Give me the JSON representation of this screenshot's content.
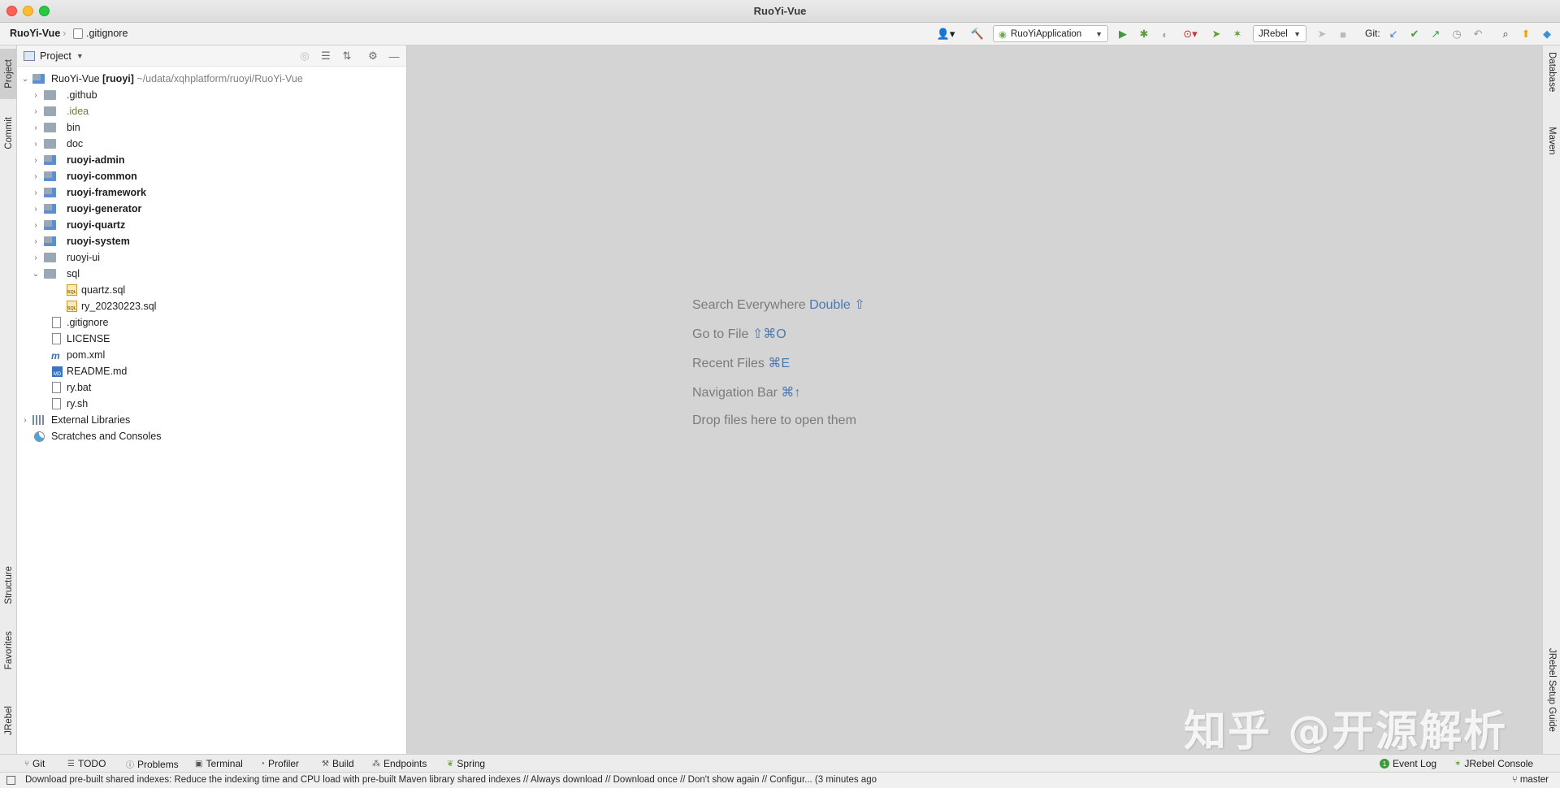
{
  "window": {
    "title": "RuoYi-Vue"
  },
  "breadcrumb": {
    "root": "RuoYi-Vue",
    "file": ".gitignore"
  },
  "toolbar": {
    "run_config": "RuoYiApplication",
    "jrebel": "JRebel",
    "git_label": "Git:"
  },
  "left_tabs": {
    "project": "Project",
    "commit": "Commit",
    "structure": "Structure",
    "favorites": "Favorites",
    "jrebel": "JRebel"
  },
  "right_tabs": {
    "database": "Database",
    "maven": "Maven",
    "jrebel_guide": "JRebel Setup Guide"
  },
  "project_panel": {
    "title": "Project",
    "tree": [
      {
        "label": "RuoYi-Vue",
        "module": "[ruoyi]",
        "path": "~/udata/xqhplatform/ruoyi/RuoYi-Vue"
      },
      {
        "label": ".github"
      },
      {
        "label": ".idea"
      },
      {
        "label": "bin"
      },
      {
        "label": "doc"
      },
      {
        "label": "ruoyi-admin"
      },
      {
        "label": "ruoyi-common"
      },
      {
        "label": "ruoyi-framework"
      },
      {
        "label": "ruoyi-generator"
      },
      {
        "label": "ruoyi-quartz"
      },
      {
        "label": "ruoyi-system"
      },
      {
        "label": "ruoyi-ui"
      },
      {
        "label": "sql"
      },
      {
        "label": "quartz.sql"
      },
      {
        "label": "ry_20230223.sql"
      },
      {
        "label": ".gitignore"
      },
      {
        "label": "LICENSE"
      },
      {
        "label": "pom.xml"
      },
      {
        "label": "README.md"
      },
      {
        "label": "ry.bat"
      },
      {
        "label": "ry.sh"
      },
      {
        "label": "External Libraries"
      },
      {
        "label": "Scratches and Consoles"
      }
    ]
  },
  "editor_hints": [
    {
      "text": "Search Everywhere",
      "key": "Double ⇧"
    },
    {
      "text": "Go to File",
      "key": "⇧⌘O"
    },
    {
      "text": "Recent Files",
      "key": "⌘E"
    },
    {
      "text": "Navigation Bar",
      "key": "⌘↑"
    },
    {
      "text": "Drop files here to open them",
      "key": ""
    }
  ],
  "watermark": "知乎 @开源解析",
  "bottom_tabs": [
    "Git",
    "TODO",
    "Problems",
    "Terminal",
    "Profiler",
    "Build",
    "Endpoints",
    "Spring",
    "Event Log",
    "JRebel Console"
  ],
  "event_log_count": "1",
  "status": {
    "message": "Download pre-built shared indexes: Reduce the indexing time and CPU load with pre-built Maven library shared indexes // Always download // Download once // Don't show again // Configur... (3 minutes ago",
    "branch": "master"
  }
}
